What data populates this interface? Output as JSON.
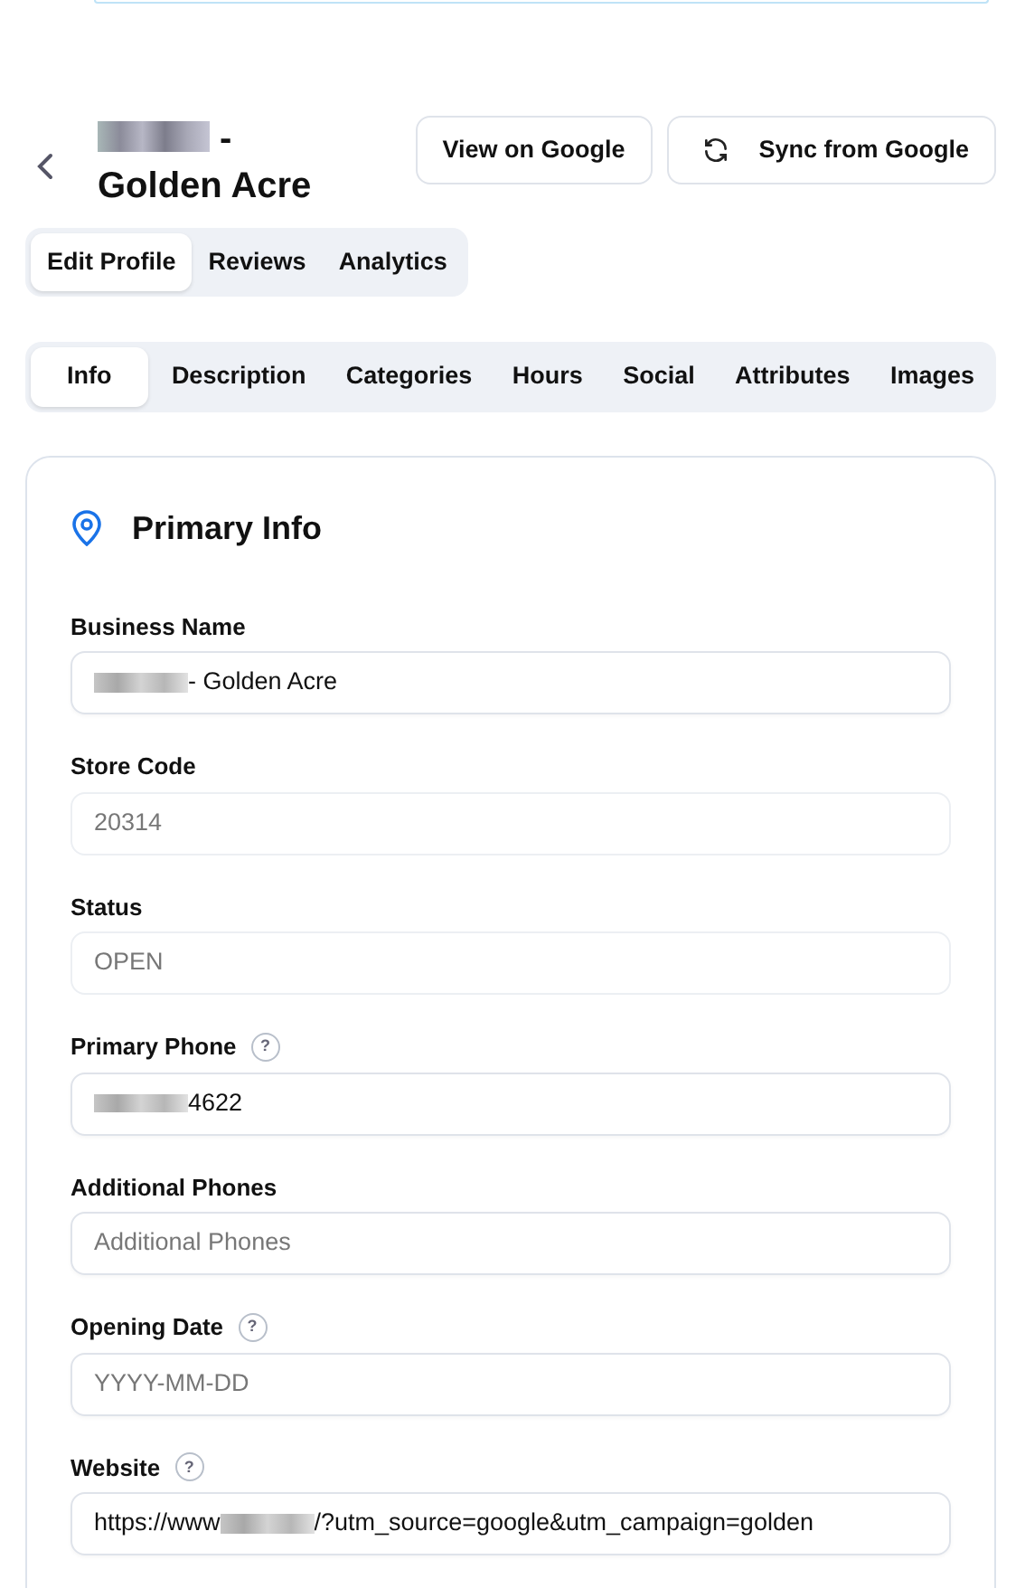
{
  "header": {
    "title_parts": [
      {
        "kind": "redacted"
      },
      {
        "kind": "text",
        "text": " -"
      },
      {
        "kind": "break"
      },
      {
        "kind": "text",
        "text": "Golden Acre"
      }
    ],
    "buttons": [
      {
        "label": "View on Google",
        "kind": "plain"
      },
      {
        "label": "Sync from Google",
        "kind": "sync"
      }
    ]
  },
  "main_tabs": [
    {
      "label": "Edit Profile",
      "selected": true
    },
    {
      "label": "Reviews",
      "selected": false
    },
    {
      "label": "Analytics",
      "selected": false
    }
  ],
  "section_tabs": [
    {
      "label": "Info",
      "selected": true
    },
    {
      "label": "Description",
      "selected": false
    },
    {
      "label": "Categories",
      "selected": false
    },
    {
      "label": "Hours",
      "selected": false
    },
    {
      "label": "Social",
      "selected": false
    },
    {
      "label": "Attributes",
      "selected": false
    },
    {
      "label": "Images",
      "selected": false
    }
  ],
  "card": {
    "title": "Primary Info",
    "fields": [
      {
        "label": "Business Name",
        "disabled": false,
        "value_parts": [
          {
            "kind": "redacted"
          },
          {
            "kind": "text",
            "text": " - Golden Acre"
          }
        ]
      },
      {
        "label": "Store Code",
        "disabled": true,
        "value_parts": [
          {
            "kind": "text",
            "text": "20314"
          }
        ]
      },
      {
        "label": "Status",
        "disabled": true,
        "value_parts": [
          {
            "kind": "text",
            "text": "OPEN"
          }
        ]
      },
      {
        "label": "Primary Phone",
        "help": "?",
        "disabled": false,
        "value_parts": [
          {
            "kind": "redacted"
          },
          {
            "kind": "text",
            "text": " 4622"
          }
        ]
      },
      {
        "label": "Additional Phones",
        "disabled": false,
        "placeholder": "Additional Phones"
      },
      {
        "label": "Opening Date",
        "help": "?",
        "disabled": false,
        "placeholder": "YYYY-MM-DD"
      },
      {
        "label": "Website",
        "help": "?",
        "disabled": false,
        "value_parts": [
          {
            "kind": "text",
            "text": "https://www"
          },
          {
            "kind": "redacted"
          },
          {
            "kind": "text",
            "text": "/?utm_source=google&utm_campaign=golden"
          }
        ]
      }
    ]
  }
}
